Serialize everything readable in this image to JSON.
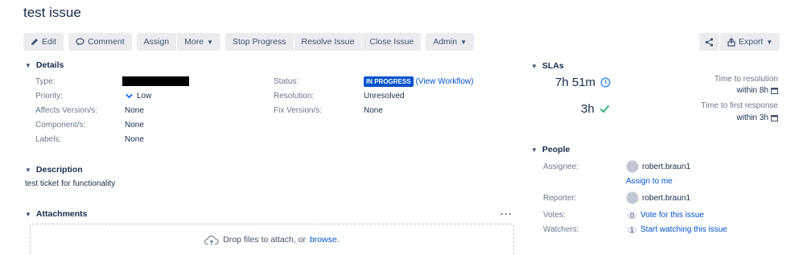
{
  "issue": {
    "title": "test issue"
  },
  "toolbar": {
    "edit": "Edit",
    "comment": "Comment",
    "assign": "Assign",
    "more": "More",
    "stop_progress": "Stop Progress",
    "resolve_issue": "Resolve Issue",
    "close_issue": "Close Issue",
    "admin": "Admin",
    "export": "Export"
  },
  "details": {
    "header": "Details",
    "type_label": "Type:",
    "priority_label": "Priority:",
    "priority_value": "Low",
    "affects_label": "Affects Version/s:",
    "affects_value": "None",
    "components_label": "Component/s:",
    "components_value": "None",
    "labels_label": "Labels:",
    "labels_value": "None",
    "status_label": "Status:",
    "status_value": "IN PROGRESS",
    "view_workflow": "(View Workflow)",
    "resolution_label": "Resolution:",
    "resolution_value": "Unresolved",
    "fix_label": "Fix Version/s:",
    "fix_value": "None"
  },
  "description": {
    "header": "Description",
    "text": "test ticket for functionality"
  },
  "attachments": {
    "header": "Attachments",
    "drop_text": "Drop files to attach, or",
    "browse": "browse."
  },
  "slas": {
    "header": "SLAs",
    "items": [
      {
        "time": "7h 51m",
        "label": "Time to resolution",
        "target": "within 8h"
      },
      {
        "time": "3h",
        "label": "Time to first response",
        "target": "within 3h"
      }
    ]
  },
  "people": {
    "header": "People",
    "assignee_label": "Assignee:",
    "assignee": "robert.braun1",
    "assign_to_me": "Assign to me",
    "reporter_label": "Reporter:",
    "reporter": "robert.braun1",
    "votes_label": "Votes:",
    "votes_count": "0",
    "vote_link": "Vote for this issue",
    "watchers_label": "Watchers:",
    "watchers_count": "1",
    "watch_link": "Start watching this issue"
  },
  "colors": {
    "accent": "#0052cc",
    "button_bg": "#ebecf0",
    "success": "#36b37e",
    "clock": "#4c9aff"
  }
}
